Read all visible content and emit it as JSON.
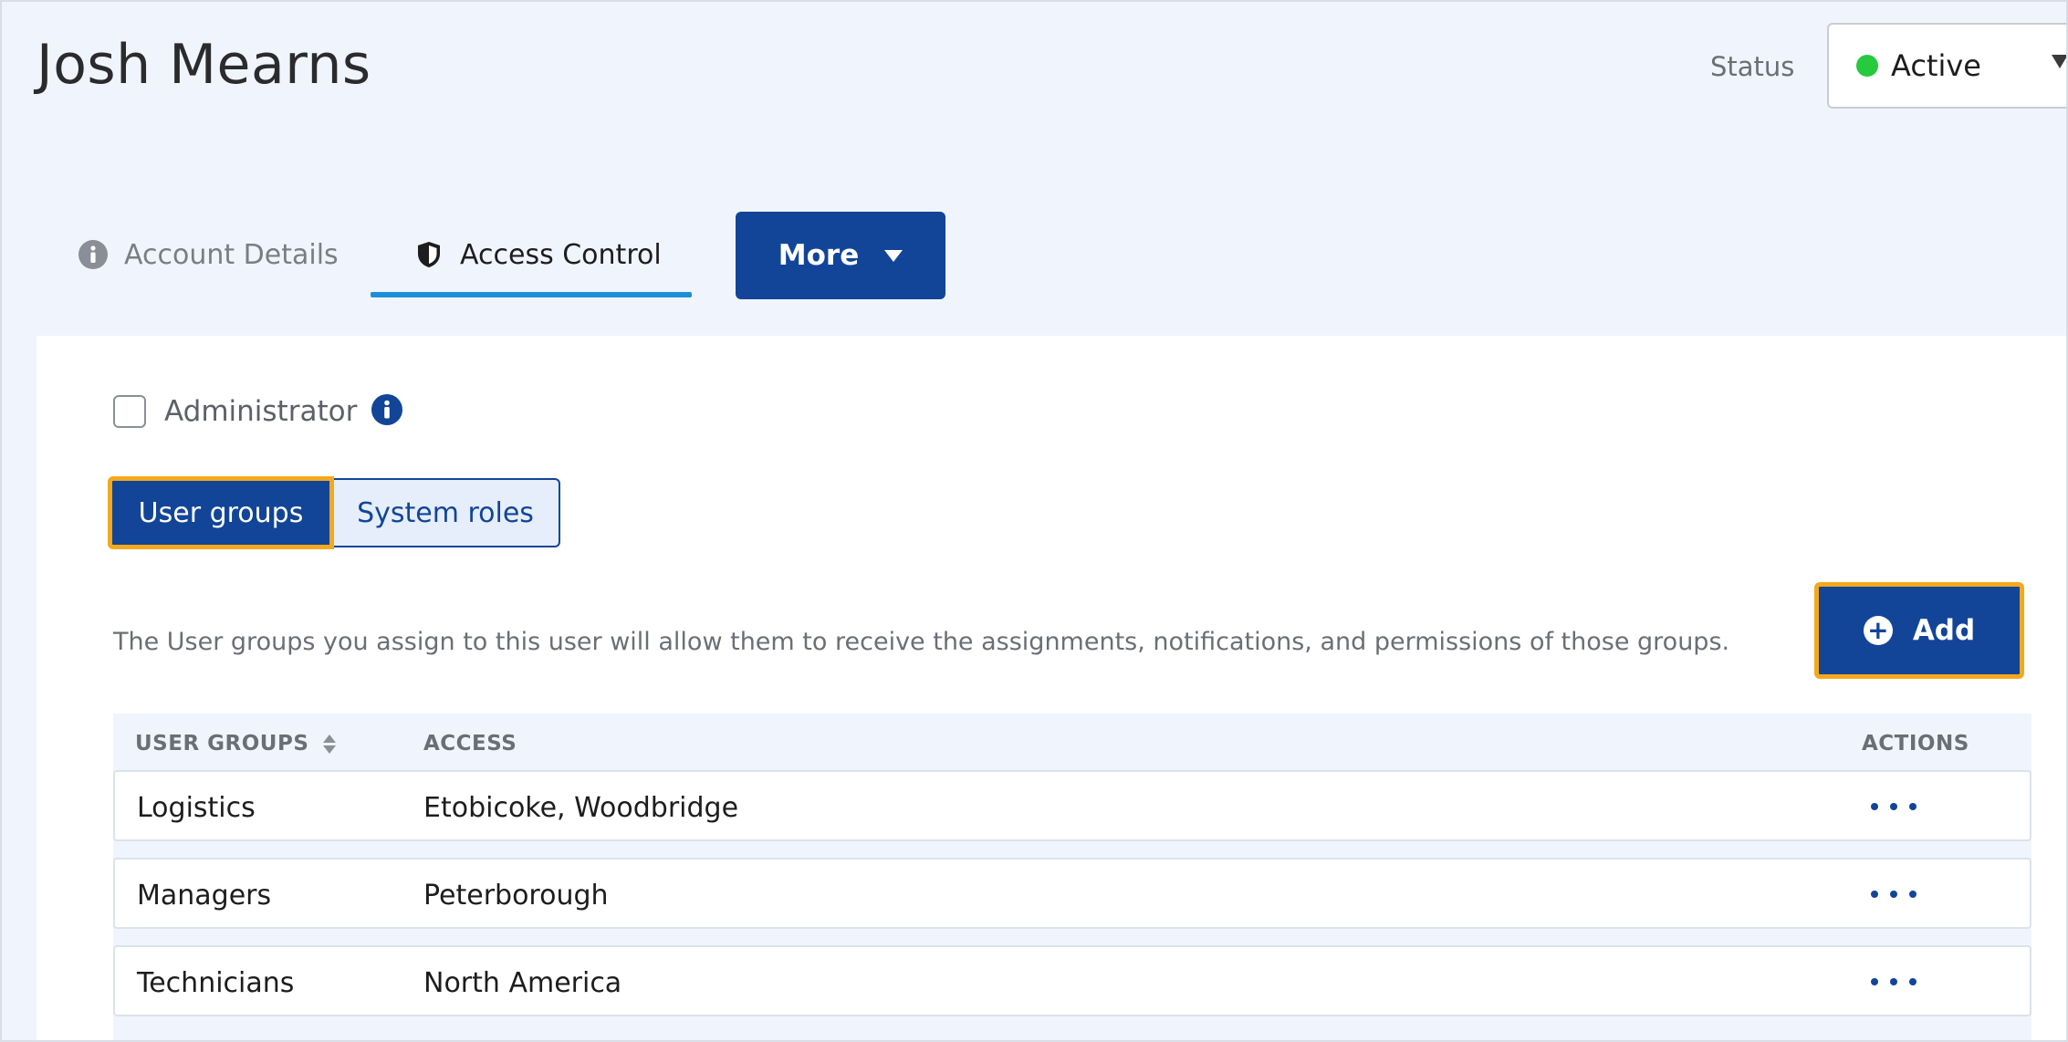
{
  "header": {
    "title": "Josh Mearns",
    "status_label": "Status",
    "status_value": "Active",
    "status_color": "#27c93f"
  },
  "tabs": [
    {
      "label": "Account Details",
      "icon": "info-icon",
      "active": false
    },
    {
      "label": "Access Control",
      "icon": "shield-icon",
      "active": true
    }
  ],
  "more_button": {
    "label": "More"
  },
  "admin": {
    "label": "Administrator",
    "checked": false
  },
  "segments": [
    {
      "label": "User groups",
      "active": true
    },
    {
      "label": "System roles",
      "active": false
    }
  ],
  "description": "The User groups you assign to this user will allow them to receive the assignments, notifications, and permissions of those groups.",
  "add_button": {
    "label": "Add"
  },
  "table": {
    "headers": {
      "groups": "USER GROUPS",
      "access": "ACCESS",
      "actions": "ACTIONS"
    },
    "rows": [
      {
        "group": "Logistics",
        "access": "Etobicoke, Woodbridge"
      },
      {
        "group": "Managers",
        "access": "Peterborough"
      },
      {
        "group": "Technicians",
        "access": "North America"
      }
    ]
  },
  "colors": {
    "primary": "#124598",
    "focus": "#f4a91c",
    "tab_underline": "#1c8fd9",
    "page_bg": "#f0f5fd"
  }
}
